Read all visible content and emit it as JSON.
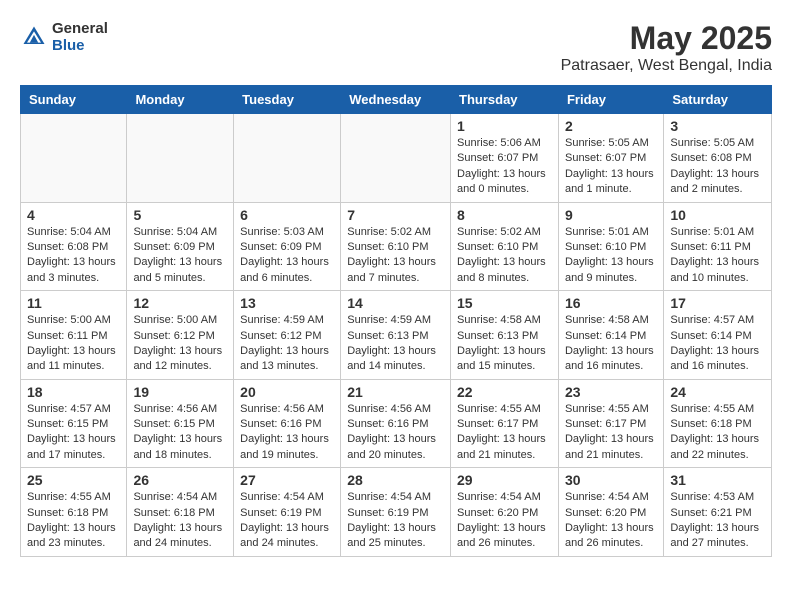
{
  "header": {
    "logo_line1": "General",
    "logo_line2": "Blue",
    "month_title": "May 2025",
    "location": "Patrasaer, West Bengal, India"
  },
  "weekdays": [
    "Sunday",
    "Monday",
    "Tuesday",
    "Wednesday",
    "Thursday",
    "Friday",
    "Saturday"
  ],
  "weeks": [
    [
      {
        "day": "",
        "info": ""
      },
      {
        "day": "",
        "info": ""
      },
      {
        "day": "",
        "info": ""
      },
      {
        "day": "",
        "info": ""
      },
      {
        "day": "1",
        "info": "Sunrise: 5:06 AM\nSunset: 6:07 PM\nDaylight: 13 hours and 0 minutes."
      },
      {
        "day": "2",
        "info": "Sunrise: 5:05 AM\nSunset: 6:07 PM\nDaylight: 13 hours and 1 minute."
      },
      {
        "day": "3",
        "info": "Sunrise: 5:05 AM\nSunset: 6:08 PM\nDaylight: 13 hours and 2 minutes."
      }
    ],
    [
      {
        "day": "4",
        "info": "Sunrise: 5:04 AM\nSunset: 6:08 PM\nDaylight: 13 hours and 3 minutes."
      },
      {
        "day": "5",
        "info": "Sunrise: 5:04 AM\nSunset: 6:09 PM\nDaylight: 13 hours and 5 minutes."
      },
      {
        "day": "6",
        "info": "Sunrise: 5:03 AM\nSunset: 6:09 PM\nDaylight: 13 hours and 6 minutes."
      },
      {
        "day": "7",
        "info": "Sunrise: 5:02 AM\nSunset: 6:10 PM\nDaylight: 13 hours and 7 minutes."
      },
      {
        "day": "8",
        "info": "Sunrise: 5:02 AM\nSunset: 6:10 PM\nDaylight: 13 hours and 8 minutes."
      },
      {
        "day": "9",
        "info": "Sunrise: 5:01 AM\nSunset: 6:10 PM\nDaylight: 13 hours and 9 minutes."
      },
      {
        "day": "10",
        "info": "Sunrise: 5:01 AM\nSunset: 6:11 PM\nDaylight: 13 hours and 10 minutes."
      }
    ],
    [
      {
        "day": "11",
        "info": "Sunrise: 5:00 AM\nSunset: 6:11 PM\nDaylight: 13 hours and 11 minutes."
      },
      {
        "day": "12",
        "info": "Sunrise: 5:00 AM\nSunset: 6:12 PM\nDaylight: 13 hours and 12 minutes."
      },
      {
        "day": "13",
        "info": "Sunrise: 4:59 AM\nSunset: 6:12 PM\nDaylight: 13 hours and 13 minutes."
      },
      {
        "day": "14",
        "info": "Sunrise: 4:59 AM\nSunset: 6:13 PM\nDaylight: 13 hours and 14 minutes."
      },
      {
        "day": "15",
        "info": "Sunrise: 4:58 AM\nSunset: 6:13 PM\nDaylight: 13 hours and 15 minutes."
      },
      {
        "day": "16",
        "info": "Sunrise: 4:58 AM\nSunset: 6:14 PM\nDaylight: 13 hours and 16 minutes."
      },
      {
        "day": "17",
        "info": "Sunrise: 4:57 AM\nSunset: 6:14 PM\nDaylight: 13 hours and 16 minutes."
      }
    ],
    [
      {
        "day": "18",
        "info": "Sunrise: 4:57 AM\nSunset: 6:15 PM\nDaylight: 13 hours and 17 minutes."
      },
      {
        "day": "19",
        "info": "Sunrise: 4:56 AM\nSunset: 6:15 PM\nDaylight: 13 hours and 18 minutes."
      },
      {
        "day": "20",
        "info": "Sunrise: 4:56 AM\nSunset: 6:16 PM\nDaylight: 13 hours and 19 minutes."
      },
      {
        "day": "21",
        "info": "Sunrise: 4:56 AM\nSunset: 6:16 PM\nDaylight: 13 hours and 20 minutes."
      },
      {
        "day": "22",
        "info": "Sunrise: 4:55 AM\nSunset: 6:17 PM\nDaylight: 13 hours and 21 minutes."
      },
      {
        "day": "23",
        "info": "Sunrise: 4:55 AM\nSunset: 6:17 PM\nDaylight: 13 hours and 21 minutes."
      },
      {
        "day": "24",
        "info": "Sunrise: 4:55 AM\nSunset: 6:18 PM\nDaylight: 13 hours and 22 minutes."
      }
    ],
    [
      {
        "day": "25",
        "info": "Sunrise: 4:55 AM\nSunset: 6:18 PM\nDaylight: 13 hours and 23 minutes."
      },
      {
        "day": "26",
        "info": "Sunrise: 4:54 AM\nSunset: 6:18 PM\nDaylight: 13 hours and 24 minutes."
      },
      {
        "day": "27",
        "info": "Sunrise: 4:54 AM\nSunset: 6:19 PM\nDaylight: 13 hours and 24 minutes."
      },
      {
        "day": "28",
        "info": "Sunrise: 4:54 AM\nSunset: 6:19 PM\nDaylight: 13 hours and 25 minutes."
      },
      {
        "day": "29",
        "info": "Sunrise: 4:54 AM\nSunset: 6:20 PM\nDaylight: 13 hours and 26 minutes."
      },
      {
        "day": "30",
        "info": "Sunrise: 4:54 AM\nSunset: 6:20 PM\nDaylight: 13 hours and 26 minutes."
      },
      {
        "day": "31",
        "info": "Sunrise: 4:53 AM\nSunset: 6:21 PM\nDaylight: 13 hours and 27 minutes."
      }
    ]
  ]
}
